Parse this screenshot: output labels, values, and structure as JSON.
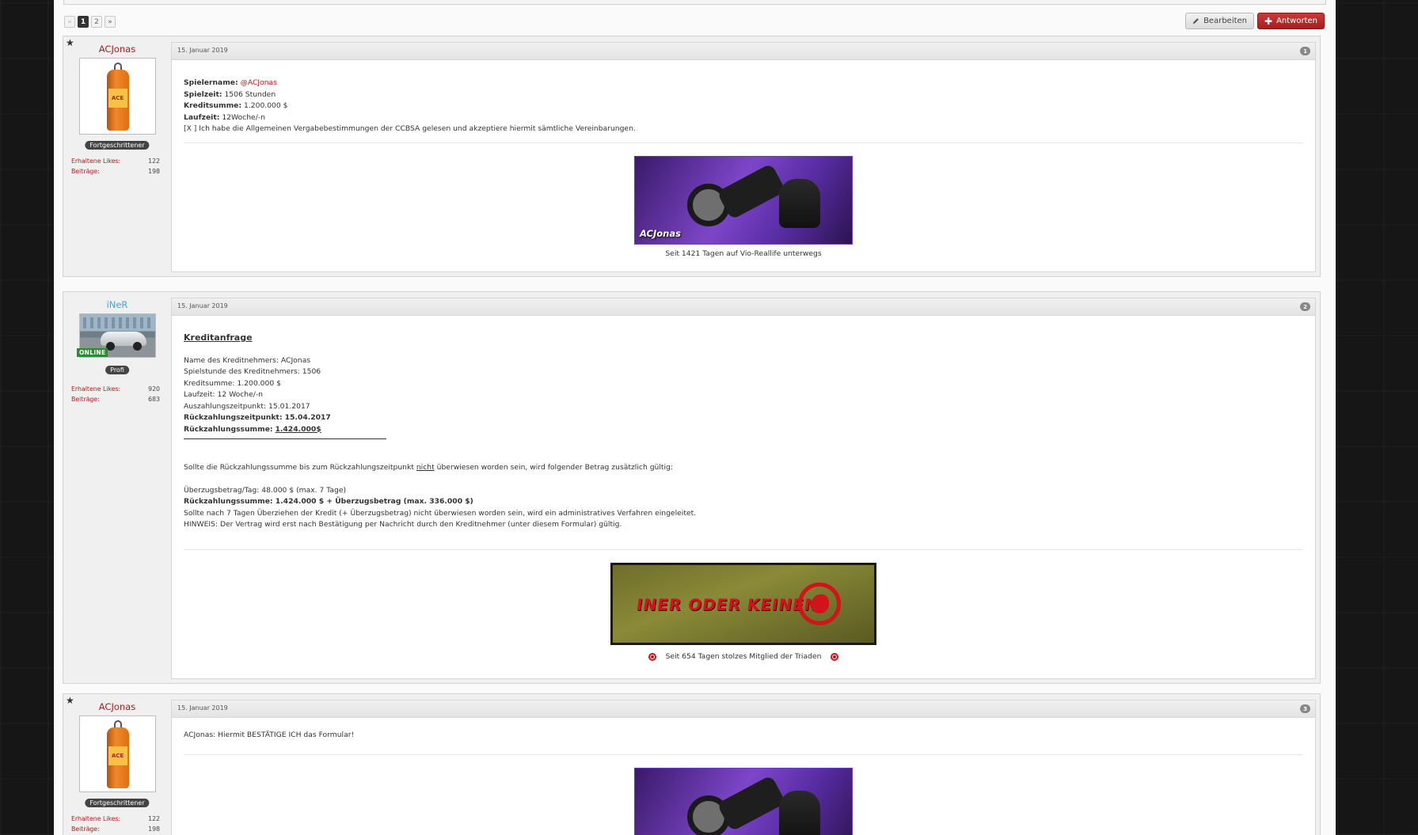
{
  "pagination": {
    "prev": "«",
    "pages": [
      "1",
      "2"
    ],
    "current": "1",
    "next": "»"
  },
  "toolbar": {
    "edit_label": "Bearbeiten",
    "reply_label": "Antworten"
  },
  "posts": [
    {
      "author": "ACJonas",
      "rank": "Fortgeschrittener",
      "likes_label": "Erhaltene Likes:",
      "likes": "122",
      "posts_label": "Beiträge:",
      "posts": "198",
      "date": "15. Januar 2019",
      "number": "1",
      "lines": [
        {
          "label": "Spielername:",
          "value": "@ACJonas"
        },
        {
          "label": "Spielzeit:",
          "value": "1506 Stunden"
        },
        {
          "label": "Kreditsumme:",
          "value": "1.200.000 $"
        },
        {
          "label": "Laufzeit:",
          "value": "12Woche/-n"
        }
      ],
      "agreement": "[X ] Ich habe die Allgemeinen Vergabebestimmungen der CCBSA gelesen und akzeptiere hiermit sämtliche Vereinbarungen.",
      "signature_tag": "ACJonas",
      "signature_caption": "Seit 1421 Tagen auf Vio-Reallife unterwegs"
    },
    {
      "author": "iNeR",
      "rank": "Profi",
      "online": "ONLINE",
      "likes_label": "Erhaltene Likes:",
      "likes": "920",
      "posts_label": "Beiträge:",
      "posts": "683",
      "date": "15. Januar 2019",
      "number": "2",
      "title": "Kreditanfrage",
      "details": [
        "Name des Kreditnehmers: ACJonas",
        "Spielstunde des Kreditnehmers: 1506",
        "Kreditsumme: 1.200.000 $",
        "Laufzeit: 12 Woche/-n",
        "Auszahlungszeitpunkt: 15.01.2017"
      ],
      "rueck_zeit": "Rückzahlungszeitpunkt: 15.04.2017",
      "rueck_summe_label": "Rückzahlungssumme:",
      "rueck_summe_value": "1.424.000$",
      "cond_a": "Sollte die Rückzahlungssumme bis zum Rückzahlungszeitpunkt",
      "cond_b": "nicht",
      "cond_c": "überwiesen worden sein, wird folgender Betrag zusätzlich gültig:",
      "ueberzug": "Überzugsbetrag/Tag: 48.000 $ (max. 7 Tage)",
      "rueck_total": "Rückzahlungssumme: 1.424.000 $ + Überzugsbetrag (max. 336.000 $)",
      "verfahren": "Sollte nach 7 Tagen Überziehen der Kredit (+ Überzugsbetrag) nicht überwiesen worden sein, wird ein administratives Verfahren eingeleitet.",
      "hinweis": "HINWEIS: Der Vertrag wird erst nach Bestätigung per Nachricht durch den Kreditnehmer (unter diesem Formular) gültig.",
      "signature_banner": "INER ODER KEINEN",
      "signature_caption": "Seit 654 Tagen stolzes Mitglied der Triaden"
    },
    {
      "author": "ACJonas",
      "rank": "Fortgeschrittener",
      "likes_label": "Erhaltene Likes:",
      "likes": "122",
      "posts_label": "Beiträge:",
      "posts": "198",
      "date": "15. Januar 2019",
      "number": "3",
      "message": "ACJonas: Hiermit BESTÄTIGE ICH das Formular!"
    }
  ],
  "bottle_label": "ACE"
}
